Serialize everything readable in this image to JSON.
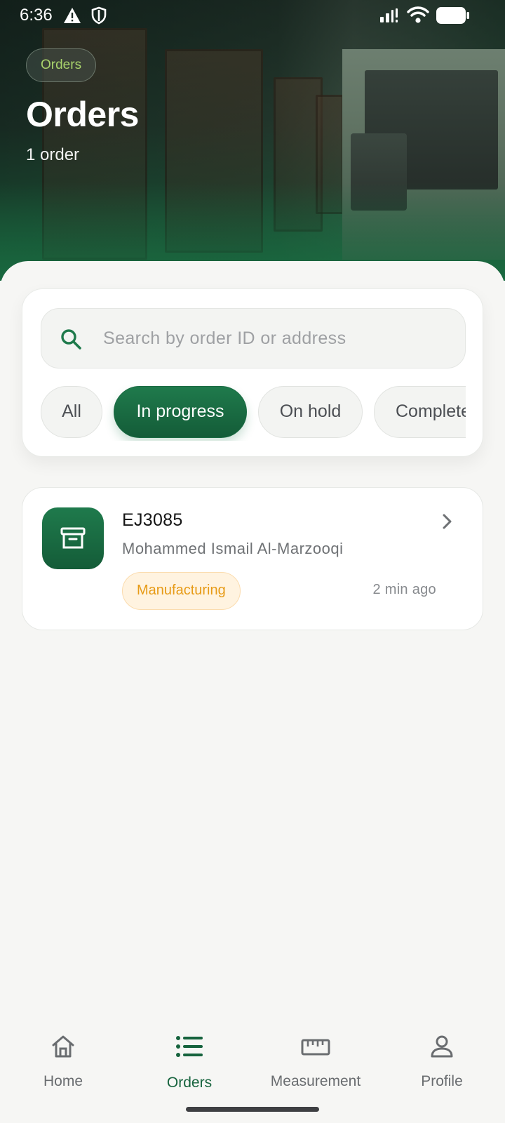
{
  "status_bar": {
    "time": "6:36"
  },
  "header": {
    "chip_label": "Orders",
    "title": "Orders",
    "subtitle": "1 order"
  },
  "search": {
    "placeholder": "Search by order ID or address",
    "value": ""
  },
  "filters": [
    {
      "label": "All",
      "active": false
    },
    {
      "label": "In progress",
      "active": true
    },
    {
      "label": "On hold",
      "active": false
    },
    {
      "label": "Completed",
      "active": false
    }
  ],
  "orders": [
    {
      "id": "EJ3085",
      "customer": "Mohammed Ismail Al-Marzooqi",
      "status": "Manufacturing",
      "time_ago": "2 min ago",
      "icon": "archive-box-icon"
    }
  ],
  "bottom_nav": {
    "items": [
      {
        "label": "Home",
        "icon": "home-icon",
        "active": false
      },
      {
        "label": "Orders",
        "icon": "list-icon",
        "active": true
      },
      {
        "label": "Measurement",
        "icon": "ruler-icon",
        "active": false
      },
      {
        "label": "Profile",
        "icon": "person-icon",
        "active": false
      }
    ]
  },
  "colors": {
    "brand_green": "#1f7a4c",
    "active_nav": "#16633d",
    "status_amber": "#e79b17",
    "header_chip_text": "#a9d36c"
  }
}
